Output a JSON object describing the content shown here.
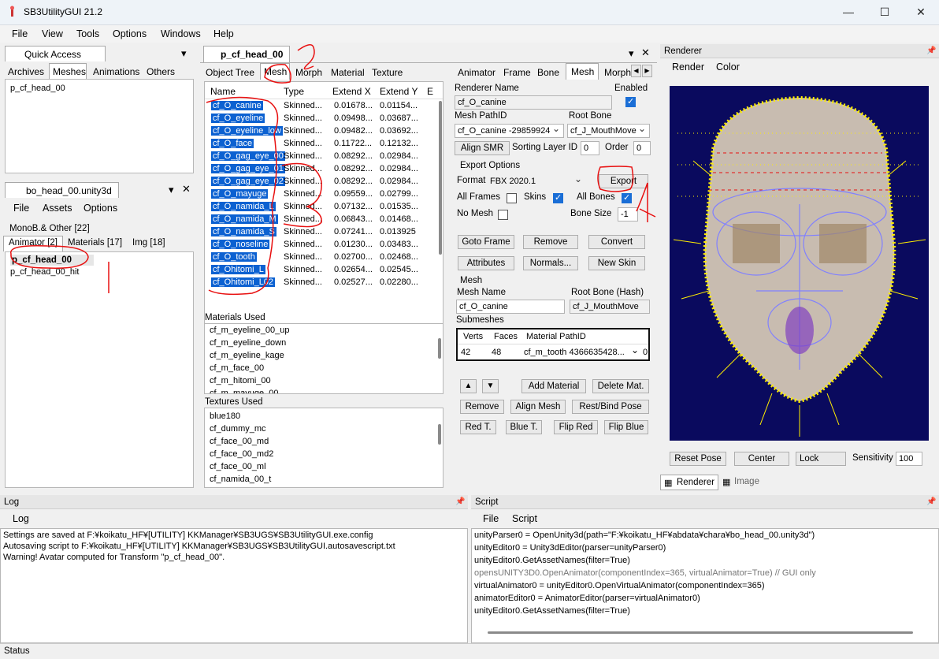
{
  "window": {
    "title": "SB3UtilityGUI 21.2"
  },
  "menu": [
    "File",
    "View",
    "Tools",
    "Options",
    "Windows",
    "Help"
  ],
  "quick_access": {
    "title": "Quick Access",
    "tabs": [
      "Archives",
      "Meshes",
      "Animations",
      "Others"
    ],
    "items": [
      "p_cf_head_00"
    ]
  },
  "unity_panel": {
    "title": "bo_head_00.unity3d",
    "menu": [
      "File",
      "Assets",
      "Options"
    ],
    "mono": "MonoB.& Other [22]",
    "tabs": [
      "Animator [2]",
      "Materials [17]",
      "Img [18]"
    ],
    "items": [
      "p_cf_head_00",
      "p_cf_head_00_hit"
    ]
  },
  "editor": {
    "doc_tab": "p_cf_head_00",
    "tabs": [
      "Object Tree",
      "Mesh",
      "Morph",
      "Material",
      "Texture"
    ],
    "columns": [
      "Name",
      "Type",
      "Extend X",
      "Extend Y",
      "E"
    ],
    "rows": [
      [
        "cf_O_canine",
        "Skinned...",
        "0.01678...",
        "0.01154..."
      ],
      [
        "cf_O_eyeline",
        "Skinned...",
        "0.09498...",
        "0.03687..."
      ],
      [
        "cf_O_eyeline_low",
        "Skinned...",
        "0.09482...",
        "0.03692..."
      ],
      [
        "cf_O_face",
        "Skinned...",
        "0.11722...",
        "0.12132..."
      ],
      [
        "cf_O_gag_eye_00",
        "Skinned...",
        "0.08292...",
        "0.02984..."
      ],
      [
        "cf_O_gag_eye_01",
        "Skinned...",
        "0.08292...",
        "0.02984..."
      ],
      [
        "cf_O_gag_eye_02",
        "Skinned...",
        "0.08292...",
        "0.02984..."
      ],
      [
        "cf_O_mayuge",
        "Skinned...",
        "0.09559...",
        "0.02799..."
      ],
      [
        "cf_O_namida_L",
        "Skinned...",
        "0.07132...",
        "0.01535..."
      ],
      [
        "cf_O_namida_M",
        "Skinned...",
        "0.06843...",
        "0.01468..."
      ],
      [
        "cf_O_namida_S",
        "Skinned...",
        "0.07241...",
        "0.013925"
      ],
      [
        "cf_O_noseline",
        "Skinned...",
        "0.01230...",
        "0.03483..."
      ],
      [
        "cf_O_tooth",
        "Skinned...",
        "0.02700...",
        "0.02468..."
      ],
      [
        "cf_Ohitomi_L",
        "Skinned...",
        "0.02654...",
        "0.02545..."
      ],
      [
        "cf_Ohitomi_L02",
        "Skinned...",
        "0.02527...",
        "0.02280..."
      ]
    ],
    "materials_used_label": "Materials Used",
    "materials": [
      "cf_m_eyeline_00_up",
      "cf_m_eyeline_down",
      "cf_m_eyeline_kage",
      "cf_m_face_00",
      "cf_m_hitomi_00",
      "cf_m_mayuge_00"
    ],
    "textures_used_label": "Textures Used",
    "textures": [
      "blue180",
      "cf_dummy_mc",
      "cf_face_00_md",
      "cf_face_00_md2",
      "cf_face_00_ml",
      "cf_namida_00_t"
    ]
  },
  "props": {
    "tabs": [
      "Animator",
      "Frame",
      "Bone",
      "Mesh",
      "Morph"
    ],
    "renderer_name_label": "Renderer Name",
    "enabled_label": "Enabled",
    "renderer_name": "cf_O_canine",
    "mesh_pathid_label": "Mesh PathID",
    "root_bone_label": "Root Bone",
    "mesh_pathid": "cf_O_canine -29859924",
    "root_bone": "cf_J_MouthMove",
    "align_smr": "Align SMR",
    "sorting_layer_label": "Sorting Layer ID",
    "sorting_layer": "0",
    "order_label": "Order",
    "order": "0",
    "export_options_label": "Export Options",
    "format_label": "Format",
    "format": "FBX 2020.1",
    "export": "Export",
    "all_frames": "All Frames",
    "skins": "Skins",
    "all_bones": "All Bones",
    "no_mesh": "No Mesh",
    "bone_size_label": "Bone Size",
    "bone_size": "-1",
    "goto_frame": "Goto Frame",
    "remove": "Remove",
    "convert": "Convert",
    "attributes": "Attributes",
    "normals": "Normals...",
    "new_skin": "New Skin",
    "mesh_label": "Mesh",
    "mesh_name_label": "Mesh Name",
    "root_bone_hash_label": "Root Bone (Hash)",
    "mesh_name": "cf_O_canine",
    "root_bone_hash": "cf_J_MouthMove",
    "submeshes_label": "Submeshes",
    "sub_cols": [
      "Verts",
      "Faces",
      "Material PathID"
    ],
    "sub_row": [
      "42",
      "48",
      "cf_m_tooth 4366635428...",
      "0"
    ],
    "up": "▲",
    "down": "▼",
    "add_material": "Add Material",
    "delete_mat": "Delete Mat.",
    "remove2": "Remove",
    "align_mesh": "Align Mesh",
    "rest_bind": "Rest/Bind Pose",
    "red_t": "Red T.",
    "blue_t": "Blue T.",
    "flip_red": "Flip Red",
    "flip_blue": "Flip Blue"
  },
  "renderer": {
    "title": "Renderer",
    "menu": [
      "Render",
      "Color"
    ],
    "reset_pose": "Reset Pose",
    "center": "Center",
    "lock": "Lock",
    "sensitivity_label": "Sensitivity",
    "sensitivity": "100",
    "tabs": [
      "Renderer",
      "Image"
    ]
  },
  "log": {
    "title": "Log",
    "menu": "Log",
    "lines": [
      "Settings are saved at F:¥koikatu_HF¥[UTILITY] KKManager¥SB3UGS¥SB3UtilityGUI.exe.config",
      "Autosaving script to F:¥koikatu_HF¥[UTILITY] KKManager¥SB3UGS¥SB3UtilityGUI.autosavescript.txt",
      "Warning! Avatar computed for Transform \"p_cf_head_00\"."
    ]
  },
  "script": {
    "title": "Script",
    "menu": [
      "File",
      "Script"
    ],
    "lines": [
      "unityParser0 = OpenUnity3d(path=\"F:¥koikatu_HF¥abdata¥chara¥bo_head_00.unity3d\")",
      "unityEditor0 = Unity3dEditor(parser=unityParser0)",
      "unityEditor0.GetAssetNames(filter=True)",
      "opensUNITY3D0.OpenAnimator(componentIndex=365, virtualAnimator=True) // GUI only",
      "virtualAnimator0 = unityEditor0.OpenVirtualAnimator(componentIndex=365)",
      "animatorEditor0 = AnimatorEditor(parser=virtualAnimator0)",
      "unityEditor0.GetAssetNames(filter=True)"
    ]
  },
  "status": "Status",
  "colors": {
    "selection": "#0c61d1",
    "viewport": "#0a0a5e",
    "annotation": "#e81010"
  }
}
